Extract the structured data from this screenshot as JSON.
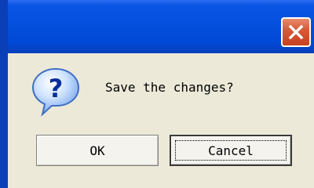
{
  "dialog": {
    "message": "Save the changes?",
    "icon": "question-icon",
    "buttons": {
      "ok_label": "OK",
      "cancel_label": "Cancel"
    }
  },
  "titlebar": {
    "close_icon": "close-icon"
  },
  "colors": {
    "titlebar_blue": "#0650df",
    "close_red": "#d85a3a",
    "dialog_bg": "#ece9d8"
  }
}
